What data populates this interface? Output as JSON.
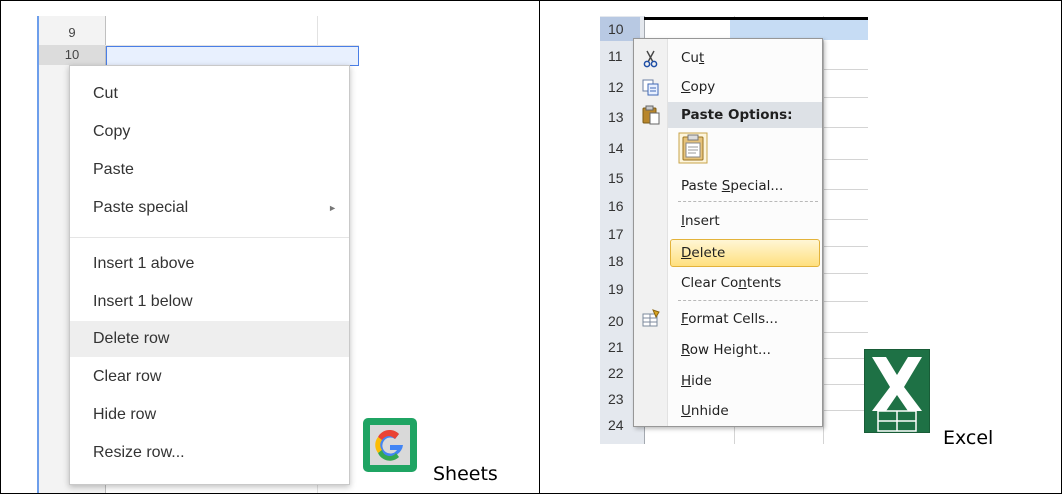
{
  "sheets": {
    "row_numbers": [
      "9",
      "10"
    ],
    "menu_items": [
      {
        "label": "Cut"
      },
      {
        "label": "Copy"
      },
      {
        "label": "Paste"
      },
      {
        "label": "Paste special",
        "submenu": true
      },
      {
        "label": "Insert 1 above"
      },
      {
        "label": "Insert 1 below"
      },
      {
        "label": "Delete row",
        "highlighted": true
      },
      {
        "label": "Clear row"
      },
      {
        "label": "Hide row"
      },
      {
        "label": "Resize row..."
      }
    ],
    "submenu_arrow": "►",
    "logo_icon": "google-sheets-logo-icon",
    "app_label": "Sheets"
  },
  "excel": {
    "row_numbers": [
      "10",
      "11",
      "12",
      "13",
      "14",
      "15",
      "16",
      "17",
      "18",
      "19",
      "20",
      "21",
      "22",
      "23",
      "24"
    ],
    "paste_options_label": "Paste Options:",
    "menu_items": {
      "cut": {
        "pre": "Cu",
        "u": "t",
        "post": ""
      },
      "copy": {
        "pre": "",
        "u": "C",
        "post": "opy"
      },
      "paste_special": {
        "pre": "Paste ",
        "u": "S",
        "post": "pecial..."
      },
      "insert": {
        "pre": "",
        "u": "I",
        "post": "nsert"
      },
      "delete": {
        "pre": "",
        "u": "D",
        "post": "elete"
      },
      "clear_contents": {
        "pre": "Clear Co",
        "u": "n",
        "post": "tents"
      },
      "format_cells": {
        "pre": "",
        "u": "F",
        "post": "ormat Cells..."
      },
      "row_height": {
        "pre": "",
        "u": "R",
        "post": "ow Height..."
      },
      "hide": {
        "pre": "",
        "u": "H",
        "post": "ide"
      },
      "unhide": {
        "pre": "",
        "u": "U",
        "post": "nhide"
      }
    },
    "highlighted_item": "delete",
    "logo_icon": "excel-logo-icon",
    "app_label": "Excel"
  },
  "colors": {
    "sheets_green": "#1fa463",
    "excel_green": "#1e7145",
    "highlight_gold": "#ffe07f"
  }
}
